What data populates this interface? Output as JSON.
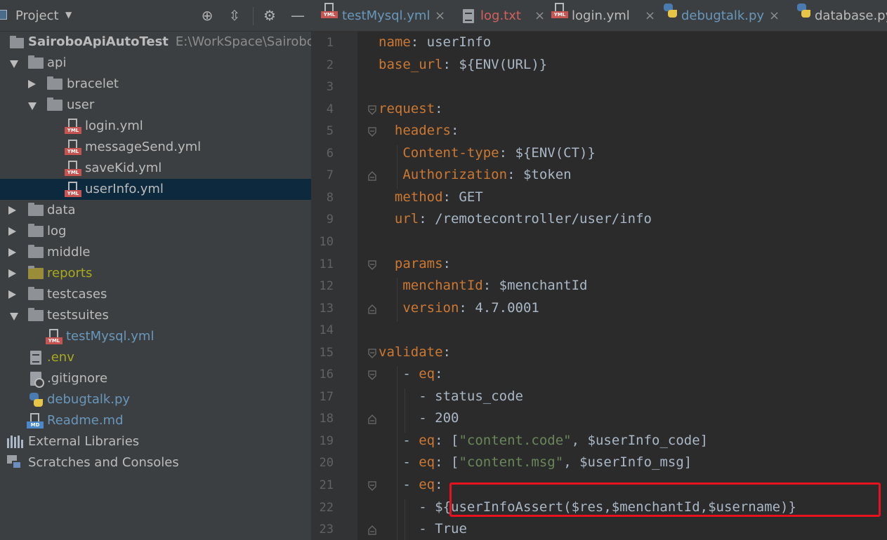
{
  "project_panel": {
    "title": "Project",
    "caret": "▼",
    "toolbar": {
      "locate_icon": "⊕",
      "collapse_icon": "⇳",
      "settings_icon": "⚙",
      "hide_icon": "—"
    },
    "root": {
      "name": "SairoboApiAutoTest",
      "path": "E:\\WorkSpace\\SairoboAp"
    },
    "items": [
      {
        "label": "api"
      },
      {
        "label": "bracelet"
      },
      {
        "label": "user"
      },
      {
        "label": "login.yml"
      },
      {
        "label": "messageSend.yml"
      },
      {
        "label": "saveKid.yml"
      },
      {
        "label": "userInfo.yml"
      },
      {
        "label": "data"
      },
      {
        "label": "log"
      },
      {
        "label": "middle"
      },
      {
        "label": "reports"
      },
      {
        "label": "testcases"
      },
      {
        "label": "testsuites"
      },
      {
        "label": "testMysql.yml"
      },
      {
        "label": ".env"
      },
      {
        "label": ".gitignore"
      },
      {
        "label": "debugtalk.py"
      },
      {
        "label": "Readme.md"
      },
      {
        "label": "External Libraries"
      },
      {
        "label": "Scratches and Consoles"
      }
    ],
    "file_badges": {
      "yml": "YML",
      "md": "MD"
    }
  },
  "tabs": [
    {
      "label": "testMysql.yml",
      "close": "×"
    },
    {
      "label": "log.txt",
      "close": "×"
    },
    {
      "label": "login.yml",
      "close": "×"
    },
    {
      "label": "debugtalk.py",
      "close": "×"
    },
    {
      "label": "database.py",
      "close": ""
    }
  ],
  "editor": {
    "line_numbers": [
      "1",
      "2",
      "3",
      "4",
      "5",
      "6",
      "7",
      "8",
      "9",
      "10",
      "11",
      "12",
      "13",
      "14",
      "15",
      "16",
      "17",
      "18",
      "19",
      "20",
      "21",
      "22",
      "23"
    ],
    "lines": [
      {
        "key": "name",
        "sep": ": ",
        "val": "userInfo"
      },
      {
        "key": "base_url",
        "sep": ": ",
        "val": "${ENV(URL)}"
      },
      {
        "key": "",
        "sep": "",
        "val": ""
      },
      {
        "key": "request",
        "sep": ":",
        "val": ""
      },
      {
        "key": "headers",
        "sep": ":",
        "val": ""
      },
      {
        "key": "Content-type",
        "sep": ": ",
        "val": "${ENV(CT)}"
      },
      {
        "key": "Authorization",
        "sep": ": ",
        "val": "$token"
      },
      {
        "key": "method",
        "sep": ": ",
        "val": "GET"
      },
      {
        "key": "url",
        "sep": ": ",
        "val": "/remotecontroller/user/info"
      },
      {
        "key": "",
        "sep": "",
        "val": ""
      },
      {
        "key": "params",
        "sep": ":",
        "val": ""
      },
      {
        "key": "menchantId",
        "sep": ": ",
        "val": "$menchantId"
      },
      {
        "key": "version",
        "sep": ": ",
        "val": "4.7.0001"
      },
      {
        "key": "",
        "sep": "",
        "val": ""
      },
      {
        "key": "validate",
        "sep": ":",
        "val": ""
      },
      {
        "dash": "- ",
        "key": "eq",
        "sep": ":",
        "val": ""
      },
      {
        "dash": "- ",
        "val": "status_code"
      },
      {
        "dash": "- ",
        "val": "200"
      },
      {
        "dash": "- ",
        "key": "eq",
        "sep": ": ",
        "lb": "[",
        "str": "\"content.code\"",
        "rest": ", $userInfo_code]"
      },
      {
        "dash": "- ",
        "key": "eq",
        "sep": ": ",
        "lb": "[",
        "str": "\"content.msg\"",
        "rest": ", $userInfo_msg]"
      },
      {
        "dash": "- ",
        "key": "eq",
        "sep": ":",
        "val": ""
      },
      {
        "dash": "- ",
        "val": "${userInfoAssert($res,$menchantId,$username)}"
      },
      {
        "dash": "- ",
        "val": "True"
      }
    ]
  },
  "colors": {
    "panel_bg": "#3c3f41",
    "editor_bg": "#2b2b2b",
    "selection": "#0d293e",
    "yaml_key": "#cc7832",
    "string": "#6a8759",
    "text": "#a9b7c6",
    "highlight_box": "#e8121f",
    "modified_file": "#6897bb",
    "ignored_folder": "#a9a91e"
  }
}
